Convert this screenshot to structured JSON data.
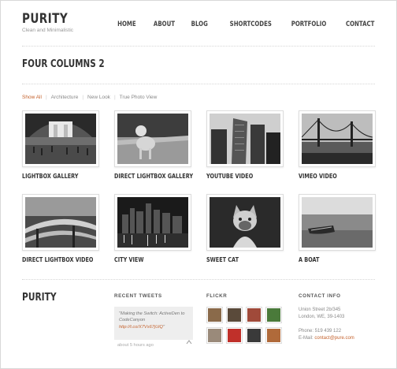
{
  "site": {
    "title": "PURITY",
    "tagline": "Clean and Minimalistic"
  },
  "nav": [
    "HOME",
    "ABOUT",
    "BLOG",
    "SHORTCODES",
    "PORTFOLIO",
    "CONTACT"
  ],
  "page": {
    "title": "FOUR COLUMNS 2"
  },
  "filters": [
    "Show All",
    "Architecture",
    "New Look",
    "True Photo View"
  ],
  "portfolio": [
    {
      "caption": "LIGHTBOX GALLERY",
      "image": "train-station-hall"
    },
    {
      "caption": "DIRECT LIGHTBOX GALLERY",
      "image": "dog-on-road"
    },
    {
      "caption": "YOUTUBE VIDEO",
      "image": "skyscrapers"
    },
    {
      "caption": "VIMEO VIDEO",
      "image": "golden-gate-bridge"
    },
    {
      "caption": "DIRECT LIGHTBOX VIDEO",
      "image": "highway-interchange"
    },
    {
      "caption": "CITY VIEW",
      "image": "city-skyline-night"
    },
    {
      "caption": "SWEET CAT",
      "image": "siamese-cat"
    },
    {
      "caption": "A BOAT",
      "image": "boat-on-beach"
    }
  ],
  "footer": {
    "logo": "PURITY",
    "tweets": {
      "heading": "RECENT TWEETS",
      "text_prefix": "\"Making the Switch: ActiveDen to CodeCanyon ",
      "link": "http://t.co/X7Vs67jUiQ",
      "text_suffix": "\"",
      "time": "about 5 hours ago"
    },
    "flickr": {
      "heading": "FLICKR"
    },
    "contact": {
      "heading": "CONTACT INFO",
      "street": "Union Street 2b/345",
      "city": "London, WE, 39-1403",
      "phone": "Phone: 519 439 122",
      "email_label": "E-Mail: ",
      "email": "contact@pure.com"
    }
  },
  "colors": {
    "accent": "#c4622d",
    "text": "#333333",
    "muted": "#888888"
  }
}
